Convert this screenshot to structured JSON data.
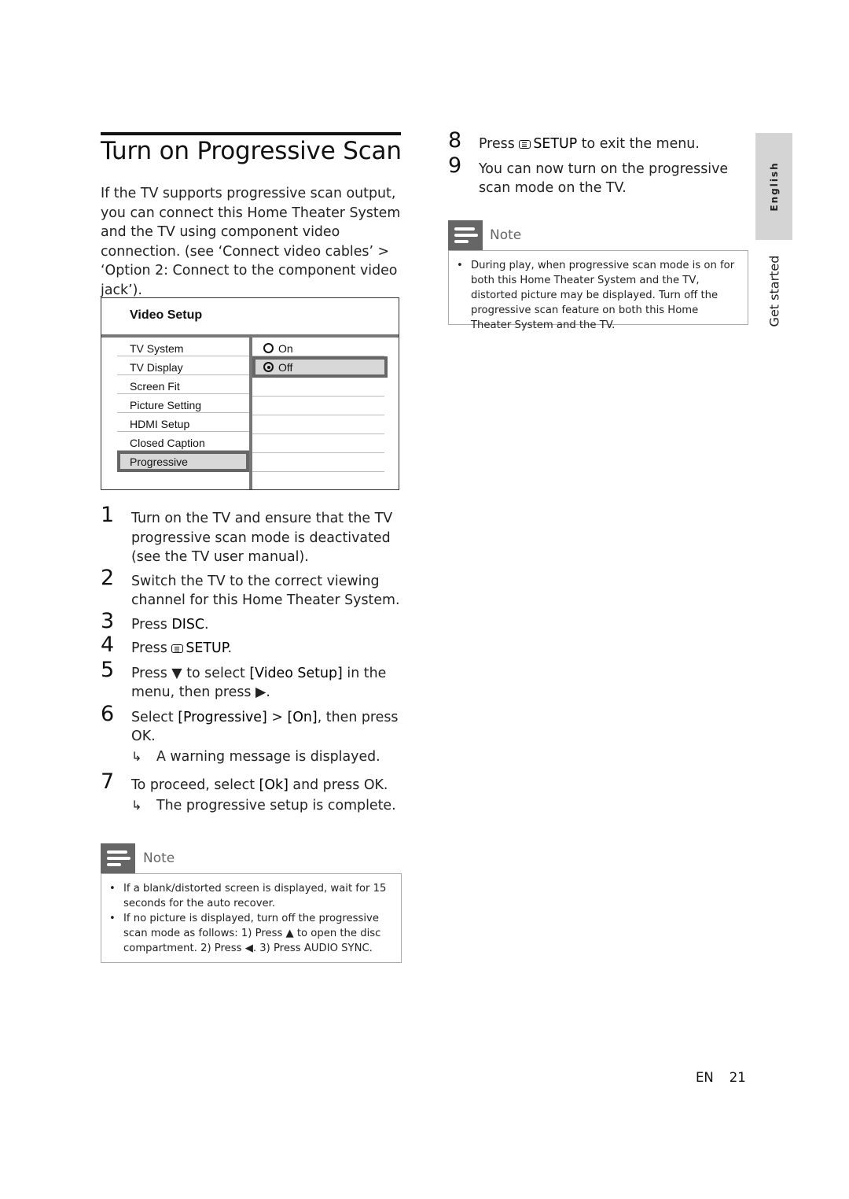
{
  "page": {
    "title": "Turn on Progressive Scan",
    "intro": "If the TV supports progressive scan output, you can connect this Home Theater System and the TV using component video connection. (see ‘Connect video cables’ > ‘Option 2: Connect to the component video jack’).",
    "side_tab_language": "English",
    "side_section": "Get started",
    "footer_lang": "EN",
    "footer_page": "21"
  },
  "menu": {
    "title": "Video Setup",
    "items": [
      {
        "label": "TV System",
        "selected": false
      },
      {
        "label": "TV Display",
        "selected": false
      },
      {
        "label": "Screen Fit",
        "selected": false
      },
      {
        "label": "Picture Setting",
        "selected": false
      },
      {
        "label": "HDMI Setup",
        "selected": false
      },
      {
        "label": "Closed Caption",
        "selected": false
      },
      {
        "label": "Progressive",
        "selected": true
      }
    ],
    "options": [
      {
        "label": "On",
        "checked": false,
        "selected": false
      },
      {
        "label": "Off",
        "checked": true,
        "selected": true
      }
    ]
  },
  "steps": [
    {
      "num": "1",
      "text": "Turn on the TV and ensure that the TV progressive scan mode is deactivated (see the TV user manual)."
    },
    {
      "num": "2",
      "text": "Switch the TV to the correct viewing channel for this Home Theater System."
    },
    {
      "num": "3",
      "pre": "Press ",
      "key": "DISC",
      "post": "."
    },
    {
      "num": "4",
      "pre": "Press ",
      "key": "SETUP",
      "post": ".",
      "icon": "setup-icon"
    },
    {
      "num": "5",
      "pre": "Press ▼ to select ",
      "key": "[Video Setup]",
      "post": " in the menu, then press ▶."
    },
    {
      "num": "6",
      "pre": "Select ",
      "key": "[Progressive]",
      "mid": " > ",
      "key2": "[On]",
      "post": ", then press OK.",
      "result": "A warning message is displayed."
    },
    {
      "num": "7",
      "pre": "To proceed, select ",
      "key": "[Ok]",
      "post": " and press OK.",
      "result": "The progressive setup is complete."
    },
    {
      "num": "8",
      "pre": "Press ",
      "key": "SETUP",
      "post": " to exit the menu.",
      "icon": "setup-icon"
    },
    {
      "num": "9",
      "text": "You can now turn on the progressive scan mode on the TV."
    }
  ],
  "notes": {
    "label": "Note",
    "left": [
      "If a blank/distorted screen is displayed, wait for 15 seconds for the auto recover.",
      "If no picture is displayed, turn off the progressive scan mode as follows: 1) Press ▲ to open the disc compartment. 2) Press ◀. 3) Press AUDIO SYNC."
    ],
    "right": [
      "During play, when progressive scan mode is on for both this Home Theater System and the TV, distorted picture may be displayed. Turn off the progressive scan feature on both this Home Theater System and the TV."
    ]
  }
}
